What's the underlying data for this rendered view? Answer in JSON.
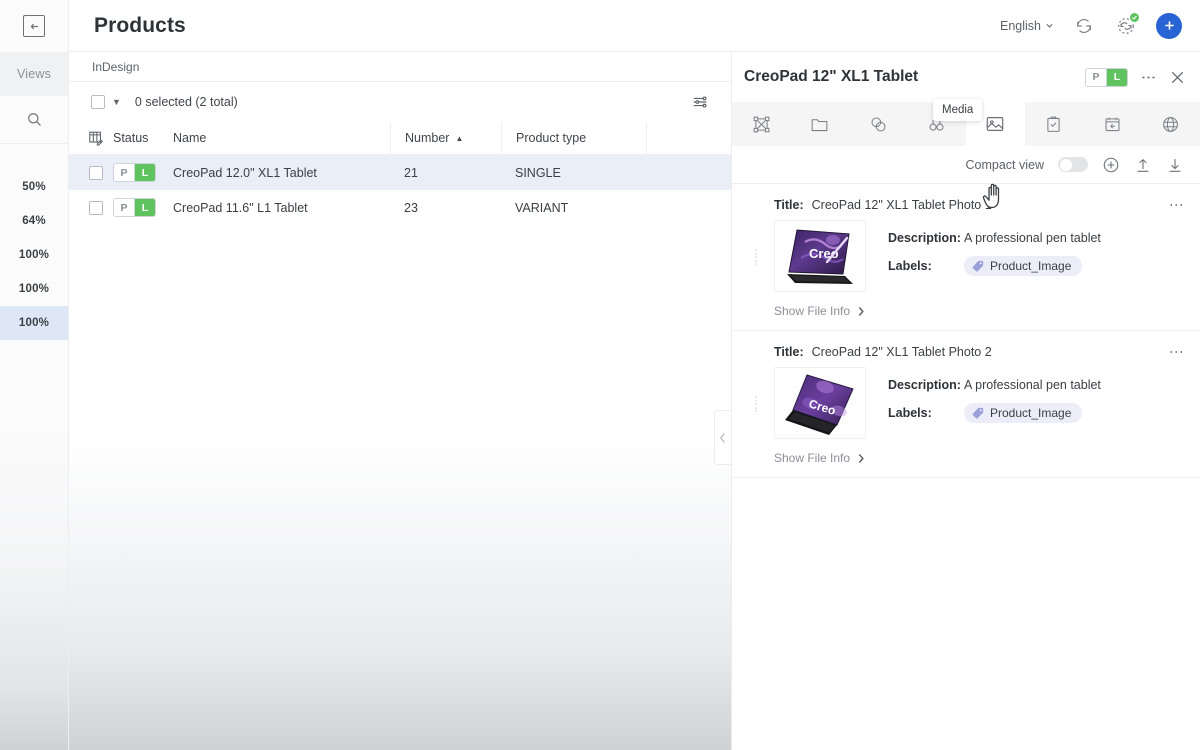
{
  "rail": {
    "collapse_icon": "collapse-left-icon",
    "views_label": "Views",
    "search_icon": "search-icon",
    "items": [
      {
        "label": "50%",
        "selected": false
      },
      {
        "label": "64%",
        "selected": false
      },
      {
        "label": "100%",
        "selected": false
      },
      {
        "label": "100%",
        "selected": false
      },
      {
        "label": "100%",
        "selected": true
      }
    ]
  },
  "header": {
    "title": "Products",
    "language": "English",
    "language_caret": "chevron-down-icon",
    "refresh_icon": "refresh-icon",
    "sync_icon": "sync-status-icon",
    "add_icon": "plus-icon"
  },
  "list": {
    "tab_label": "InDesign",
    "selection_text": "0 selected (2 total)",
    "filter_icon": "filter-settings-icon",
    "columns": [
      "Status",
      "Name",
      "Number",
      "Product type"
    ],
    "sort_column": "Number",
    "sort_direction": "ascending",
    "rows": [
      {
        "status": [
          "P",
          "L"
        ],
        "name": "CreoPad 12.0\" XL1 Tablet",
        "number": "21",
        "type": "SINGLE",
        "active": true
      },
      {
        "status": [
          "P",
          "L"
        ],
        "name": "CreoPad 11.6\" L1 Tablet",
        "number": "23",
        "type": "VARIANT",
        "active": false
      }
    ],
    "collapse_panel_icon": "chevron-left-icon"
  },
  "panel": {
    "title": "CreoPad 12\" XL1 Tablet",
    "status_badge": [
      "P",
      "L"
    ],
    "kebab_icon": "more-vertical-icon",
    "close_icon": "close-icon",
    "tabs": [
      {
        "name": "attributes-tab",
        "icon": "nodes-icon",
        "active": false
      },
      {
        "name": "folders-tab",
        "icon": "folder-icon",
        "active": false
      },
      {
        "name": "relations-tab",
        "icon": "link-circles-icon",
        "active": false
      },
      {
        "name": "variants-tab",
        "icon": "variants-icon",
        "active": false
      },
      {
        "name": "media-tab",
        "icon": "image-icon",
        "active": true
      },
      {
        "name": "tasks-tab",
        "icon": "clipboard-check-icon",
        "active": false
      },
      {
        "name": "imports-tab",
        "icon": "calendar-arrow-icon",
        "active": false
      },
      {
        "name": "channels-tab",
        "icon": "globe-icon",
        "active": false
      }
    ],
    "tooltip": "Media",
    "toolbar": {
      "compact_view_label": "Compact view",
      "compact_view_on": false,
      "add_icon": "plus-circle-icon",
      "upload_icon": "upload-icon",
      "download_icon": "download-icon"
    },
    "media": [
      {
        "title_label": "Title:",
        "title": "CreoPad 12\" XL1 Tablet Photo 1",
        "description_label": "Description:",
        "description": "A professional pen tablet",
        "labels_label": "Labels:",
        "chip": "Product_Image",
        "chip_icon": "tag-icon",
        "show_file_info": "Show File Info",
        "thumb_alt": "creopad-tablet-open-front"
      },
      {
        "title_label": "Title:",
        "title": "CreoPad 12\" XL1 Tablet Photo 2",
        "description_label": "Description:",
        "description": "A professional pen tablet",
        "labels_label": "Labels:",
        "chip": "Product_Image",
        "chip_icon": "tag-icon",
        "show_file_info": "Show File Info",
        "thumb_alt": "creopad-tablet-angled"
      }
    ]
  },
  "colors": {
    "accent_blue": "#2864d4",
    "status_green": "#5fc45f",
    "row_active": "#e9eef8",
    "chip_bg": "#ecedf8"
  }
}
